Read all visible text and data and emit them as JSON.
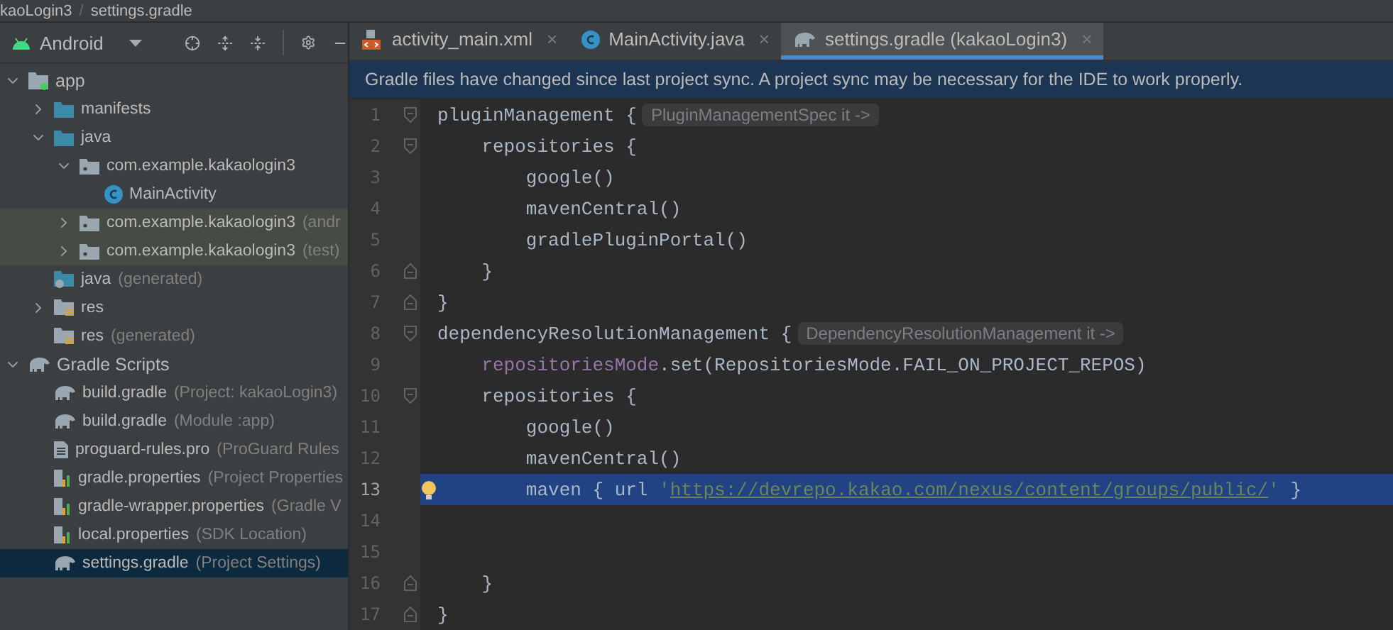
{
  "breadcrumb": {
    "project": "kaoLogin3",
    "separator": "/",
    "file": "settings.gradle"
  },
  "project_view": {
    "selector": "Android"
  },
  "tree": [
    {
      "name": "app",
      "kind": "module",
      "expanded": true,
      "selected": false,
      "highlighted": false,
      "children": [
        {
          "name": "manifests",
          "kind": "folder",
          "expanded": false,
          "selected": false,
          "highlighted": false
        },
        {
          "name": "java",
          "kind": "folder",
          "expanded": true,
          "selected": false,
          "highlighted": false,
          "children": [
            {
              "name": "com.example.kakaologin3",
              "kind": "package",
              "expanded": true,
              "selected": false,
              "highlighted": false,
              "children": [
                {
                  "name": "MainActivity",
                  "kind": "class",
                  "selected": false,
                  "highlighted": false
                }
              ]
            },
            {
              "name": "com.example.kakaologin3",
              "hint": "(andr",
              "kind": "package",
              "expanded": false,
              "selected": false,
              "highlighted": true
            },
            {
              "name": "com.example.kakaologin3",
              "hint": "(test)",
              "kind": "package",
              "expanded": false,
              "selected": false,
              "highlighted": true
            }
          ]
        },
        {
          "name": "java",
          "hint": "(generated)",
          "kind": "genfolder",
          "selected": false,
          "highlighted": false
        },
        {
          "name": "res",
          "kind": "res",
          "expanded": false,
          "selected": false,
          "highlighted": false
        },
        {
          "name": "res",
          "hint": "(generated)",
          "kind": "res",
          "selected": false,
          "highlighted": false
        }
      ]
    },
    {
      "name": "Gradle Scripts",
      "kind": "gradle",
      "expanded": true,
      "selected": false,
      "highlighted": false,
      "children": [
        {
          "name": "build.gradle",
          "hint": "(Project: kakaoLogin3)",
          "kind": "gradle",
          "selected": false,
          "highlighted": false
        },
        {
          "name": "build.gradle",
          "hint": "(Module :app)",
          "kind": "gradle",
          "selected": false,
          "highlighted": false
        },
        {
          "name": "proguard-rules.pro",
          "hint": "(ProGuard Rules",
          "kind": "file",
          "selected": false,
          "highlighted": false
        },
        {
          "name": "gradle.properties",
          "hint": "(Project Properties",
          "kind": "props",
          "selected": false,
          "highlighted": false
        },
        {
          "name": "gradle-wrapper.properties",
          "hint": "(Gradle V",
          "kind": "props",
          "selected": false,
          "highlighted": false
        },
        {
          "name": "local.properties",
          "hint": "(SDK Location)",
          "kind": "props",
          "selected": false,
          "highlighted": false
        },
        {
          "name": "settings.gradle",
          "hint": "(Project Settings)",
          "kind": "gradle",
          "selected": true,
          "highlighted": false
        }
      ]
    }
  ],
  "tabs": [
    {
      "label": "activity_main.xml",
      "kind": "xml",
      "close": "×",
      "selected": false
    },
    {
      "label": "MainActivity.java",
      "kind": "class",
      "close": "×",
      "selected": false
    },
    {
      "label": "settings.gradle (kakaoLogin3)",
      "kind": "gradle",
      "close": "×",
      "selected": true
    }
  ],
  "banner": "Gradle files have changed since last project sync. A project sync may be necessary for the IDE to work properly.",
  "lines": [
    {
      "number": "1",
      "kind": "open",
      "current": false,
      "tokens": [
        {
          "kind": "plain",
          "text": "pluginManagement {"
        },
        {
          "kind": "hint",
          "text": "PluginManagementSpec it ->"
        }
      ]
    },
    {
      "number": "2",
      "kind": "open",
      "current": false,
      "tokens": [
        {
          "kind": "plain",
          "text": "    repositories {"
        }
      ]
    },
    {
      "number": "3",
      "kind": "plain",
      "current": false,
      "tokens": [
        {
          "kind": "plain",
          "text": "        google()"
        }
      ]
    },
    {
      "number": "4",
      "kind": "plain",
      "current": false,
      "tokens": [
        {
          "kind": "plain",
          "text": "        mavenCentral()"
        }
      ]
    },
    {
      "number": "5",
      "kind": "plain",
      "current": false,
      "tokens": [
        {
          "kind": "plain",
          "text": "        gradlePluginPortal()"
        }
      ]
    },
    {
      "number": "6",
      "kind": "close",
      "current": false,
      "tokens": [
        {
          "kind": "plain",
          "text": "    }"
        }
      ]
    },
    {
      "number": "7",
      "kind": "close",
      "current": false,
      "tokens": [
        {
          "kind": "plain",
          "text": "}"
        }
      ]
    },
    {
      "number": "8",
      "kind": "open",
      "current": false,
      "tokens": [
        {
          "kind": "plain",
          "text": "dependencyResolutionManagement {"
        },
        {
          "kind": "hint",
          "text": "DependencyResolutionManagement it ->"
        }
      ]
    },
    {
      "number": "9",
      "kind": "plain",
      "current": false,
      "tokens": [
        {
          "kind": "prop",
          "text": "    repositoriesMode"
        },
        {
          "kind": "plain",
          "text": ".set(RepositoriesMode.FAIL_ON_PROJECT_REPOS)"
        }
      ]
    },
    {
      "number": "10",
      "kind": "open",
      "current": false,
      "tokens": [
        {
          "kind": "plain",
          "text": "    repositories {"
        }
      ]
    },
    {
      "number": "11",
      "kind": "plain",
      "current": false,
      "tokens": [
        {
          "kind": "plain",
          "text": "        google()"
        }
      ]
    },
    {
      "number": "12",
      "kind": "plain",
      "current": false,
      "tokens": [
        {
          "kind": "plain",
          "text": "        mavenCentral()"
        }
      ]
    },
    {
      "number": "13",
      "kind": "plain",
      "current": true,
      "bulb": true,
      "tokens": [
        {
          "kind": "plain",
          "text": "        maven { url "
        },
        {
          "kind": "str",
          "text": "'"
        },
        {
          "kind": "url",
          "text": "https://devrepo.kakao.com/nexus/content/groups/public/"
        },
        {
          "kind": "str",
          "text": "'"
        },
        {
          "kind": "plain",
          "text": " }"
        }
      ]
    },
    {
      "number": "14",
      "kind": "plain",
      "current": false
    },
    {
      "number": "15",
      "kind": "plain",
      "current": false
    },
    {
      "number": "16",
      "kind": "close",
      "current": false,
      "tokens": [
        {
          "kind": "plain",
          "text": "    }"
        }
      ]
    },
    {
      "number": "17",
      "kind": "close",
      "current": false,
      "tokens": [
        {
          "kind": "plain",
          "text": "}"
        }
      ]
    }
  ]
}
